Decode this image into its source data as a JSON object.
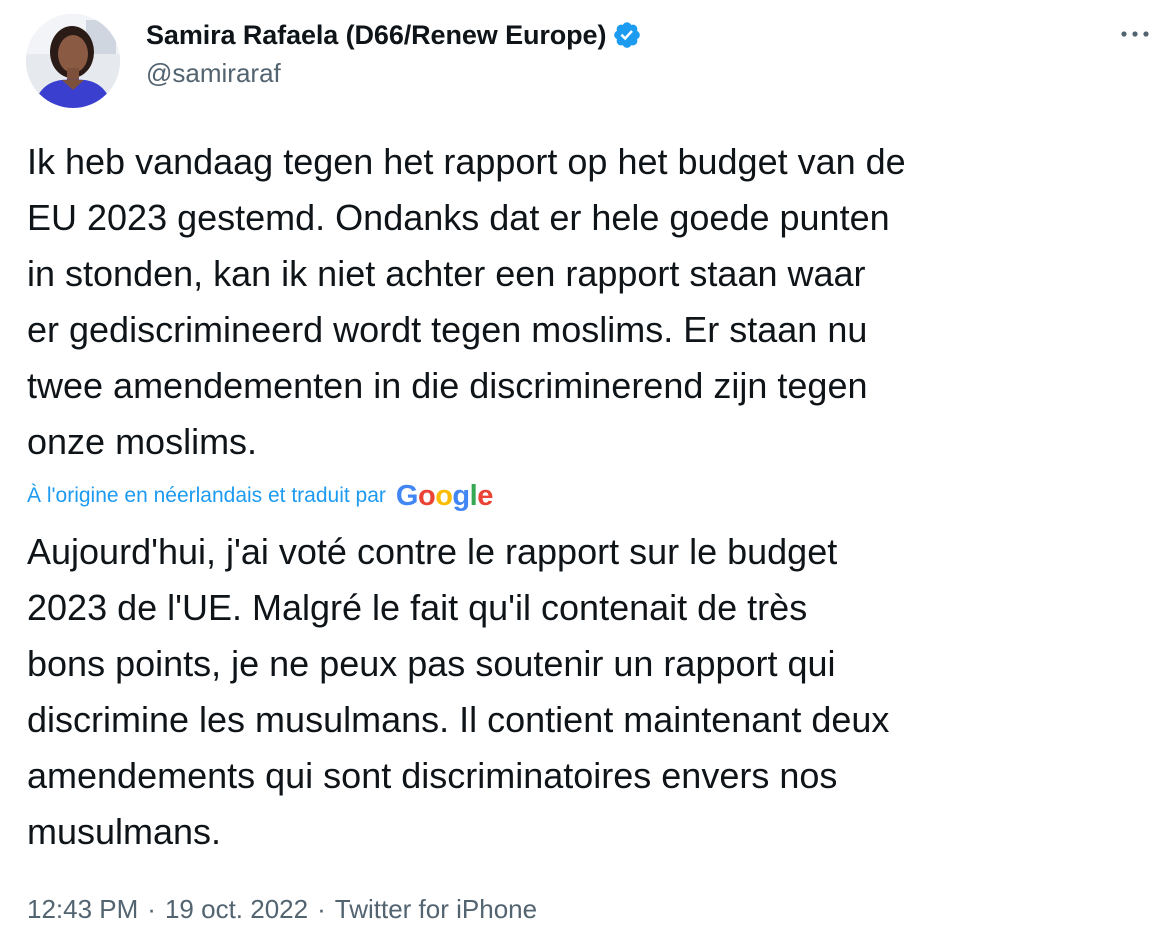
{
  "author": {
    "display_name": "Samira Rafaela (D66/Renew Europe)",
    "handle": "@samiraraf",
    "verified": true
  },
  "tweet": {
    "original_text": "Ik heb vandaag tegen het rapport op het budget van de\nEU 2023 gestemd. Ondanks dat er hele goede punten\nin stonden, kan ik niet achter een rapport staan waar\ner gediscrimineerd wordt tegen moslims. Er staan nu\ntwee amendementen in die discriminerend zijn tegen\nonze moslims.",
    "translation_note": "À l'origine en néerlandais et traduit par",
    "translation_provider": {
      "letters": [
        "G",
        "o",
        "o",
        "g",
        "l",
        "e"
      ],
      "colors": [
        "#4285f4",
        "#ea4335",
        "#fbbc05",
        "#4285f4",
        "#34a853",
        "#ea4335"
      ]
    },
    "translated_text": "Aujourd'hui, j'ai voté contre le rapport sur le budget\n2023 de l'UE. Malgré le fait qu'il contenait de très\nbons points, je ne peux pas soutenir un rapport qui\ndiscrimine les musulmans. Il contient maintenant deux\namendements qui sont discriminatoires envers nos\nmusulmans.",
    "time": "12:43 PM",
    "date": "19 oct. 2022",
    "source": "Twitter for iPhone",
    "separator": "·"
  },
  "icons": {
    "verified": "verified-badge-icon",
    "more": "more-options-icon"
  },
  "colors": {
    "text": "#0f1419",
    "secondary": "#536471",
    "accent": "#1d9bf0"
  }
}
